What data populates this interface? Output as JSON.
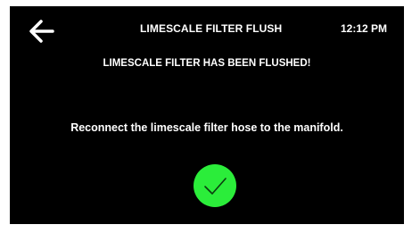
{
  "header": {
    "back_icon": "arrow-left-icon",
    "title": "LIMESCALE FILTER FLUSH",
    "time": "12:12  PM"
  },
  "main": {
    "headline": "LIMESCALE FILTER HAS BEEN FLUSHED!",
    "instruction": "Reconnect the limescale filter hose to the manifold.",
    "confirm_icon": "checkmark-icon"
  },
  "colors": {
    "background": "#000000",
    "text": "#ffffff",
    "accent_green": "#2bed3a"
  }
}
